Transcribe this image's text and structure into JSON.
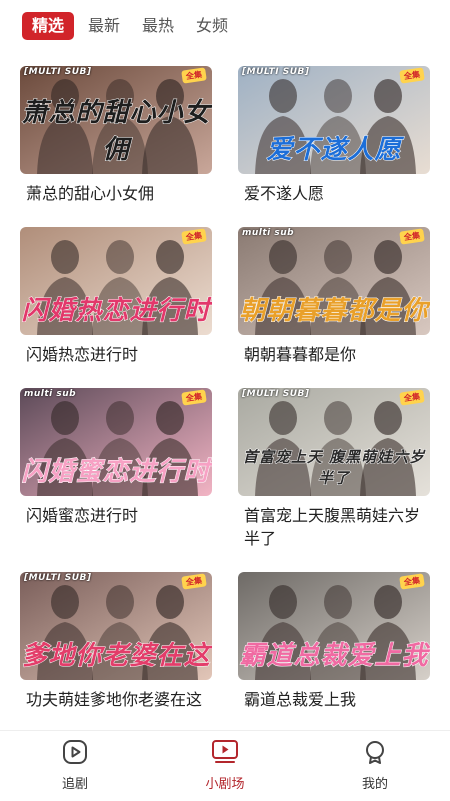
{
  "tabs": [
    "精选",
    "最新",
    "最热",
    "女频"
  ],
  "cards": [
    {
      "title": "萧总的甜心小女佣",
      "overlay": "萧总的甜心小女佣",
      "tag": "[MULTI SUB]",
      "badge": "全集",
      "colors": [
        "#6b4a3c",
        "#c9a79a"
      ],
      "ink": "#1e1e1e"
    },
    {
      "title": "爱不遂人愿",
      "overlay": "爱不遂人愿",
      "tag": "[MULTI SUB]",
      "badge": "全集",
      "colors": [
        "#9fb1c4",
        "#e8ddd2"
      ],
      "ink": "#1c6ed8"
    },
    {
      "title": "闪婚热恋进行时",
      "overlay": "闪婚热恋进行时",
      "tag": "",
      "badge": "全集",
      "colors": [
        "#b08e7a",
        "#ecdcd0"
      ],
      "ink": "#e2386b"
    },
    {
      "title": "朝朝暮暮都是你",
      "overlay": "朝朝暮暮都是你",
      "tag": "multi sub",
      "badge": "全集",
      "colors": [
        "#8a7a72",
        "#d8c8c0"
      ],
      "ink": "#e9a02a"
    },
    {
      "title": "闪婚蜜恋进行时",
      "overlay": "闪婚蜜恋进行时",
      "tag": "multi sub",
      "badge": "全集",
      "colors": [
        "#5c4a58",
        "#f2b4c4"
      ],
      "ink": "#f7a1c4"
    },
    {
      "title": "首富宠上天腹黑萌娃六岁半了",
      "overlay": "首富宠上天 腹黑萌娃六岁半了",
      "tag": "[MULTI SUB]",
      "badge": "全集",
      "colors": [
        "#a9a9a1",
        "#e5e1da"
      ],
      "ink": "#2a2a2a"
    },
    {
      "title": "功夫萌娃爹地你老婆在这",
      "overlay": "爹地你老婆在这",
      "tag": "[MULTI SUB]",
      "badge": "全集",
      "colors": [
        "#7a5e5a",
        "#e2c6b8"
      ],
      "ink": "#e33d6a"
    },
    {
      "title": "霸道总裁爱上我",
      "overlay": "霸道总裁爱上我",
      "tag": "",
      "badge": "全集",
      "colors": [
        "#6e6a66",
        "#d6d0c9"
      ],
      "ink": "#f06aa2"
    }
  ],
  "nav": [
    {
      "label": "追剧",
      "icon": "play-circle-icon"
    },
    {
      "label": "小剧场",
      "icon": "play-screen-icon"
    },
    {
      "label": "我的",
      "icon": "user-icon"
    }
  ],
  "accent": "#d1242a"
}
